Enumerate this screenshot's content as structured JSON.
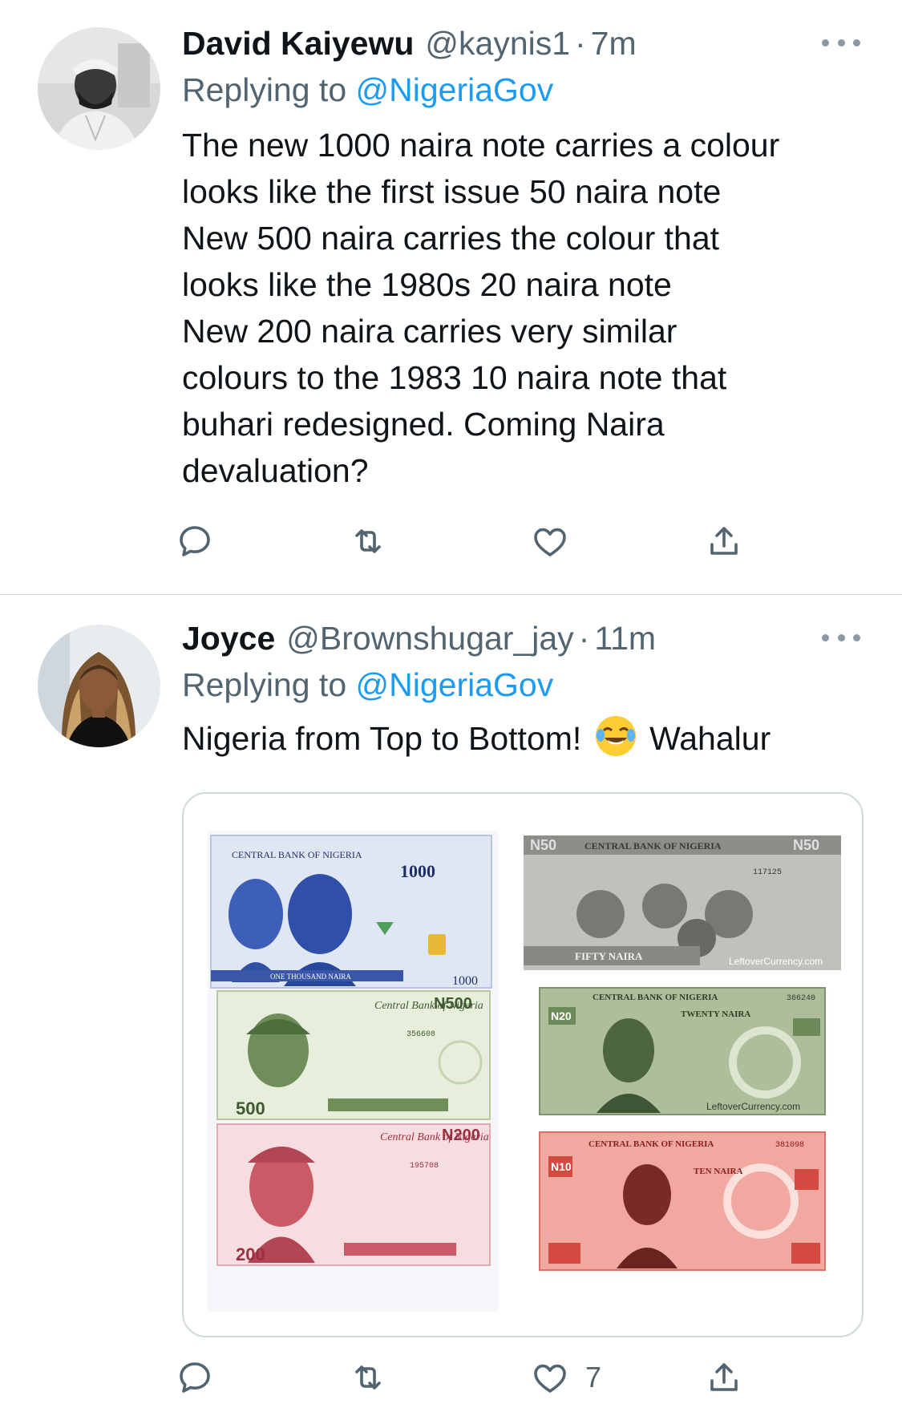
{
  "tweets": [
    {
      "name": "David Kaiyewu",
      "handle": "@kaynis1",
      "separator": "·",
      "time": "7m",
      "replying_prefix": "Replying to ",
      "replying_to": "@NigeriaGov",
      "text_lines": [
        "The new 1000 naira note carries a colour",
        "looks like the first issue 50 naira note",
        "New 500 naira carries the colour that",
        "looks like the 1980s 20 naira note",
        "New 200 naira carries very similar",
        "colours to the 1983 10 naira note that",
        "buhari redesigned. Coming Naira",
        "devaluation?"
      ],
      "actions": {
        "reply_icon": "reply-icon",
        "retweet_icon": "retweet-icon",
        "like_icon": "heart-icon",
        "like_count": "",
        "share_icon": "share-icon"
      }
    },
    {
      "name": "Joyce",
      "handle": "@Brownshugar_jay",
      "separator": "·",
      "time": "11m",
      "replying_prefix": "Replying to ",
      "replying_to": "@NigeriaGov",
      "text_before_emoji": "Nigeria from Top to Bottom! ",
      "emoji": "face-with-tears-of-joy",
      "text_after_emoji": " Wahalur",
      "actions": {
        "reply_icon": "reply-icon",
        "retweet_icon": "retweet-icon",
        "like_icon": "heart-icon",
        "like_count": "7",
        "share_icon": "share-icon"
      }
    }
  ],
  "media": {
    "new_notes": [
      {
        "issuer": "CENTRAL BANK OF NIGERIA",
        "denomination": "1000",
        "words": "ONE THOUSAND NAIRA",
        "color": "#5b7fcf"
      },
      {
        "issuer": "Central Bank of Nigeria",
        "denomination": "N500",
        "value": "500",
        "serial": "356608",
        "color": "#8fb37e"
      },
      {
        "issuer": "Central Bank of Nigeria",
        "denomination": "N200",
        "value": "200",
        "serial": "195708",
        "color": "#e27c84"
      }
    ],
    "old_notes": [
      {
        "issuer": "CENTRAL BANK OF NIGERIA",
        "denomination": "N50",
        "words": "FIFTY NAIRA",
        "serial": "117125",
        "watermark": "LeftoverCurrency.com",
        "color": "#9a9a9a"
      },
      {
        "issuer": "CENTRAL BANK OF NIGERIA",
        "denomination": "N20",
        "words": "TWENTY NAIRA",
        "serial": "366240",
        "watermark": "LeftoverCurrency.com",
        "color": "#6e8a5e"
      },
      {
        "issuer": "CENTRAL BANK OF NIGERIA",
        "denomination": "N10",
        "words": "TEN NAIRA",
        "serial": "381098",
        "color": "#e06060"
      }
    ]
  },
  "colors": {
    "link": "#1d9bf0",
    "secondary": "#536471",
    "divider": "#d6d9db",
    "border": "#cfd9de"
  }
}
